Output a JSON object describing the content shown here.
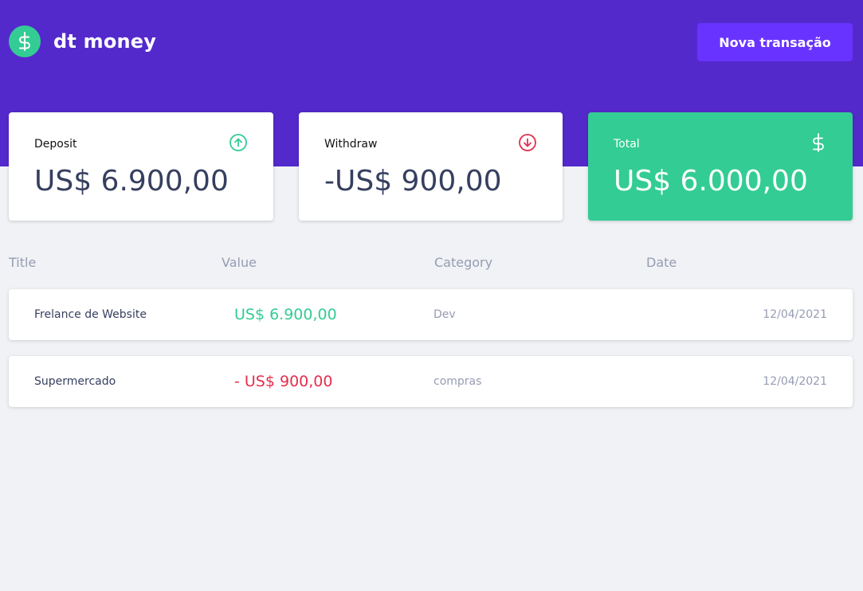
{
  "app": {
    "name": "dt money",
    "new_transaction_label": "Nova transação"
  },
  "summary": {
    "deposit": {
      "label": "Deposit",
      "value": "US$ 6.900,00",
      "icon": "arrow-up-circle-icon"
    },
    "withdraw": {
      "label": "Withdraw",
      "value": "-US$ 900,00",
      "icon": "arrow-down-circle-icon"
    },
    "total": {
      "label": "Total",
      "value": "US$ 6.000,00",
      "icon": "dollar-icon"
    }
  },
  "table": {
    "columns": [
      "Title",
      "Value",
      "Category",
      "Date"
    ],
    "rows": [
      {
        "title": "Frelance de Website",
        "value": "US$ 6.900,00",
        "type": "deposit",
        "category": "Dev",
        "date": "12/04/2021"
      },
      {
        "title": "Supermercado",
        "value": "- US$ 900,00",
        "type": "withdraw",
        "category": "compras",
        "date": "12/04/2021"
      }
    ]
  },
  "colors": {
    "header": "#5429cc",
    "button": "#6933ff",
    "green": "#33cc95",
    "red": "#e52e4d",
    "text": "#363f5f",
    "muted": "#969cb3",
    "background": "#f0f2f5"
  }
}
